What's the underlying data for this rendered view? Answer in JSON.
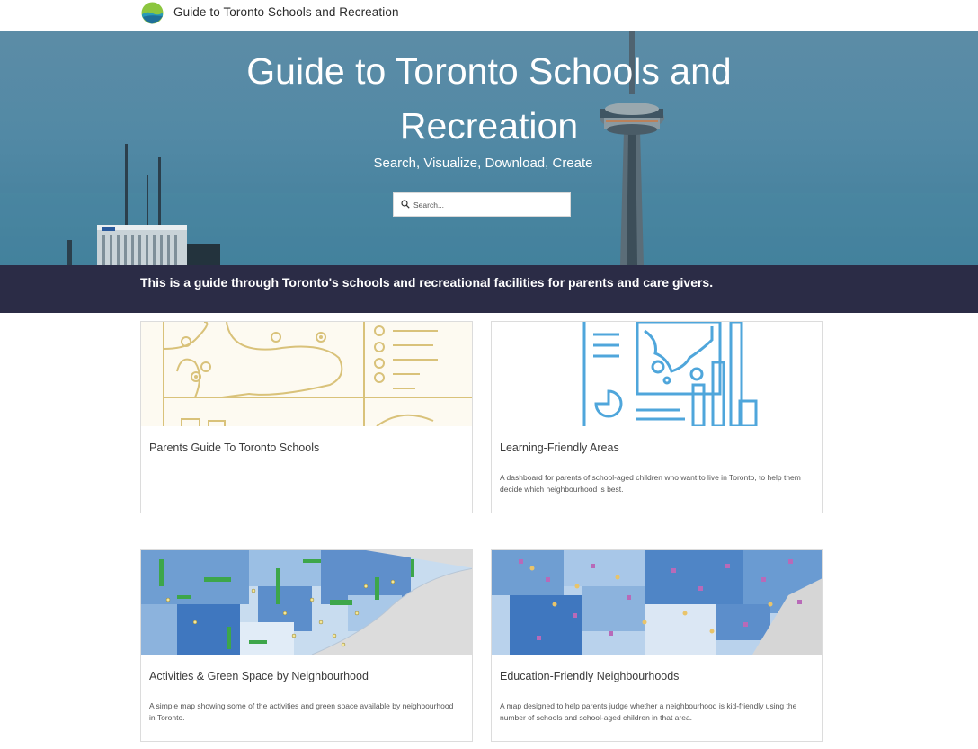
{
  "header": {
    "site_title": "Guide to Toronto Schools and Recreation",
    "logo_icon": "leaf-landscape-logo-icon"
  },
  "hero": {
    "title_line1": "Guide to Toronto Schools and",
    "title_line2": "Recreation",
    "subtitle": "Search, Visualize, Download, Create",
    "search_placeholder": "Search...",
    "search_icon": "search-icon",
    "sky_color": "#5289a5"
  },
  "banner": {
    "text": "This is a guide through Toronto's schools and recreational facilities for parents and care givers.",
    "background": "#2b2c46"
  },
  "cards": [
    {
      "title": "Parents Guide To Toronto Schools",
      "description": "",
      "thumbnail": "map-sketch-illustration"
    },
    {
      "title": "Learning-Friendly Areas",
      "description": "A dashboard for parents of school-aged children who want to live in Toronto, to help them decide which neighbourhood is best.",
      "thumbnail": "dashboard-illustration"
    },
    {
      "title": "Activities & Green Space by Neighbourhood",
      "description": "A simple map showing some of the activities and green space available by neighbourhood in Toronto.",
      "thumbnail": "green-space-map"
    },
    {
      "title": "Education-Friendly Neighbourhoods",
      "description": "A map designed to help parents judge whether a neighbourhood is kid-friendly using the number of schools and school-aged children in that area.",
      "thumbnail": "schools-map"
    }
  ]
}
